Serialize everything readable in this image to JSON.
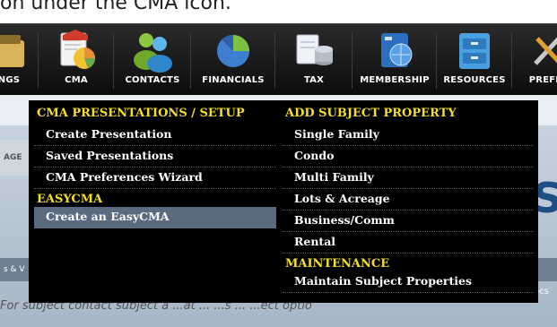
{
  "caption": "on under the CMA icon.",
  "toolbar": {
    "items": [
      {
        "label": "NGS",
        "icon": "listings-icon"
      },
      {
        "label": "CMA",
        "icon": "cma-icon"
      },
      {
        "label": "CONTACTS",
        "icon": "contacts-icon"
      },
      {
        "label": "FINANCIALS",
        "icon": "financials-icon"
      },
      {
        "label": "TAX",
        "icon": "tax-icon"
      },
      {
        "label": "MEMBERSHIP",
        "icon": "membership-icon"
      },
      {
        "label": "RESOURCES",
        "icon": "resources-icon"
      },
      {
        "label": "PREFER",
        "icon": "preferences-icon"
      }
    ]
  },
  "dropdown": {
    "left": {
      "heading1": "CMA PRESENTATIONS / SETUP",
      "items1": [
        "Create Presentation",
        "Saved Presentations",
        "CMA Preferences Wizard"
      ],
      "heading2": "EASYCMA",
      "items2": [
        "Create an EasyCMA"
      ]
    },
    "right": {
      "heading1": "ADD SUBJECT PROPERTY",
      "items1": [
        "Single Family",
        "Condo",
        "Multi Family",
        "Lots & Acreage",
        "Business/Comm",
        "Rental"
      ],
      "heading2": "MAINTENANCE",
      "items2": [
        "Maintain Subject Properties"
      ]
    }
  },
  "background": {
    "left_tab": "AGE",
    "left_tab2": "s & V",
    "big_letter": "S",
    "right_fragment": "ocs",
    "bottom_text": "For subject contact subject a ...at ... ...s ... ...ect optio"
  },
  "colors": {
    "heading": "#f4df2a",
    "highlight": "#5a6b80",
    "dropdown_bg": "#000000"
  }
}
